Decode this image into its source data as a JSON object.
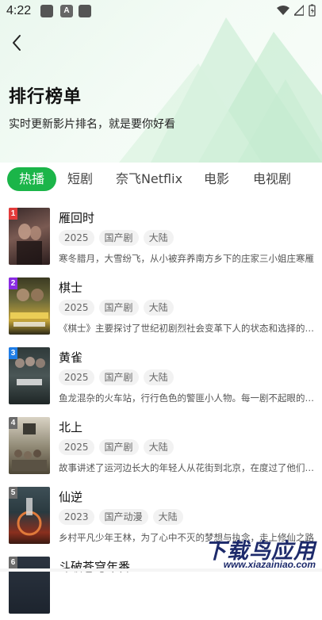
{
  "status_bar": {
    "time": "4:22",
    "icons": [
      "notification-square-icon",
      "font-a-icon",
      "notification-square-icon",
      "wifi-icon",
      "signal-icon",
      "battery-icon"
    ],
    "a_glyph": "A"
  },
  "header": {
    "title": "排行榜单",
    "subtitle": "实时更新影片排名，就是要你好看",
    "back_icon": "chevron-left-icon"
  },
  "tabs": [
    {
      "label": "热播",
      "active": true
    },
    {
      "label": "短剧",
      "active": false
    },
    {
      "label": "奈飞Netflix",
      "active": false
    },
    {
      "label": "电影",
      "active": false
    },
    {
      "label": "电视剧",
      "active": false
    }
  ],
  "accent_color": "#1bb549",
  "rank_colors": [
    "#e23b3b",
    "#8a2be2",
    "#1f7de6",
    "#6b6b6b",
    "#6b6b6b"
  ],
  "items": [
    {
      "rank": "1",
      "title": "雁回时",
      "tags": [
        "2025",
        "国产剧",
        "大陆"
      ],
      "desc": "寒冬腊月，大雪纷飞，从小被弃养南方乡下的庄家三小姐庄寒雁"
    },
    {
      "rank": "2",
      "title": "棋士",
      "tags": [
        "2025",
        "国产剧",
        "大陆"
      ],
      "desc": "《棋士》主要探讨了世纪初剧烈社会变革下人的状态和选择的故事"
    },
    {
      "rank": "3",
      "title": "黄雀",
      "tags": [
        "2025",
        "国产剧",
        "大陆"
      ],
      "desc": "鱼龙混杂的火车站，行行色色的警匪小人物。每一剧不起眼的故事"
    },
    {
      "rank": "4",
      "title": "北上",
      "tags": [
        "2025",
        "国产剧",
        "大陆"
      ],
      "desc": "故事讲述了运河边长大的年轻人从花街到北京，在度过了他们的青春"
    },
    {
      "rank": "5",
      "title": "仙逆",
      "tags": [
        "2023",
        "国产动漫",
        "大陆"
      ],
      "desc": "乡村平凡少年王林，为了心中不灭的梦想与执念，走上修仙之路"
    },
    {
      "rank": "6",
      "title": "斗破苍穹年番",
      "tags": [],
      "desc": ""
    }
  ],
  "watermark": {
    "big": "下载鸟应用",
    "small": "www.xiazainiao.com"
  }
}
